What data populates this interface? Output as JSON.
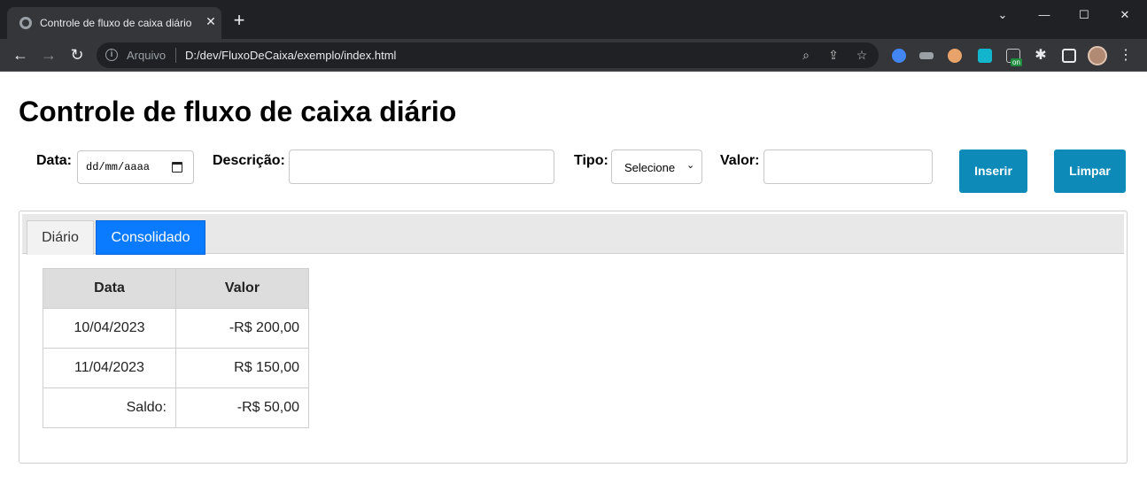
{
  "browser": {
    "tab_title": "Controle de fluxo de caixa diário",
    "tab_close": "✕",
    "new_tab": "+",
    "scheme_label": "Arquivo",
    "url": "D:/dev/FluxoDeCaixa/exemplo/index.html",
    "icons": [
      "back-arrow-icon",
      "forward-arrow-icon",
      "reload-icon",
      "info-icon",
      "zoom-icon",
      "share-icon",
      "star-icon",
      "extensions-icon",
      "side-panel-icon",
      "kebab-menu-icon"
    ],
    "ext_badge": "on"
  },
  "page": {
    "title": "Controle de fluxo de caixa diário"
  },
  "form": {
    "data_label": "Data:",
    "data_placeholder": "dd/mm/aaaa",
    "descricao_label": "Descrição:",
    "tipo_label": "Tipo:",
    "tipo_selected": "Selecione",
    "valor_label": "Valor:",
    "insert_button": "Inserir",
    "clear_button": "Limpar"
  },
  "tabs": {
    "diario": "Diário",
    "consolidado": "Consolidado",
    "active": "consolidado"
  },
  "table": {
    "headers": [
      "Data",
      "Valor"
    ],
    "rows": [
      {
        "data": "10/04/2023",
        "valor": "-R$ 200,00"
      },
      {
        "data": "11/04/2023",
        "valor": "R$ 150,00"
      }
    ],
    "saldo_label": "Saldo:",
    "saldo_value": "-R$ 50,00"
  },
  "colors": {
    "button": "#0d8ab8",
    "active_tab": "#0a7aff",
    "header_bg": "#dddddd"
  }
}
